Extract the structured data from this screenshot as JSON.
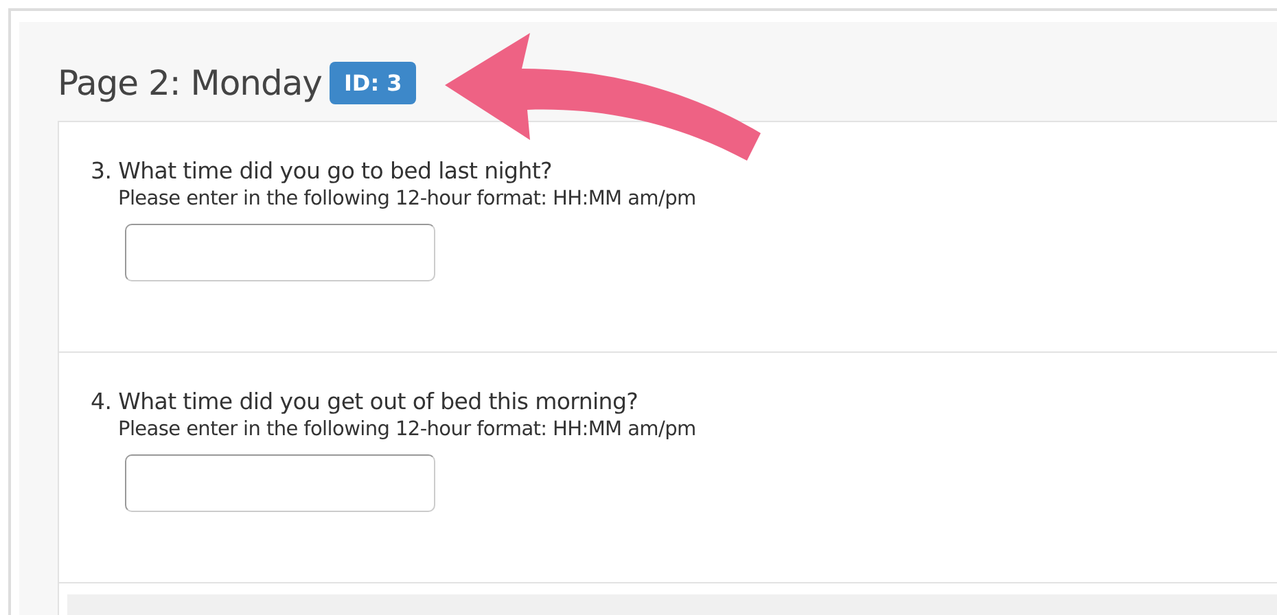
{
  "page": {
    "title": "Page 2: Monday",
    "id_badge": "ID: 3"
  },
  "questions": [
    {
      "label": "3. What time did you go to bed last night?",
      "hint": "Please enter in the following 12-hour format: HH:MM am/pm"
    },
    {
      "label": "4. What time did you get out of bed this morning?",
      "hint": "Please enter in the following 12-hour format: HH:MM am/pm"
    }
  ]
}
